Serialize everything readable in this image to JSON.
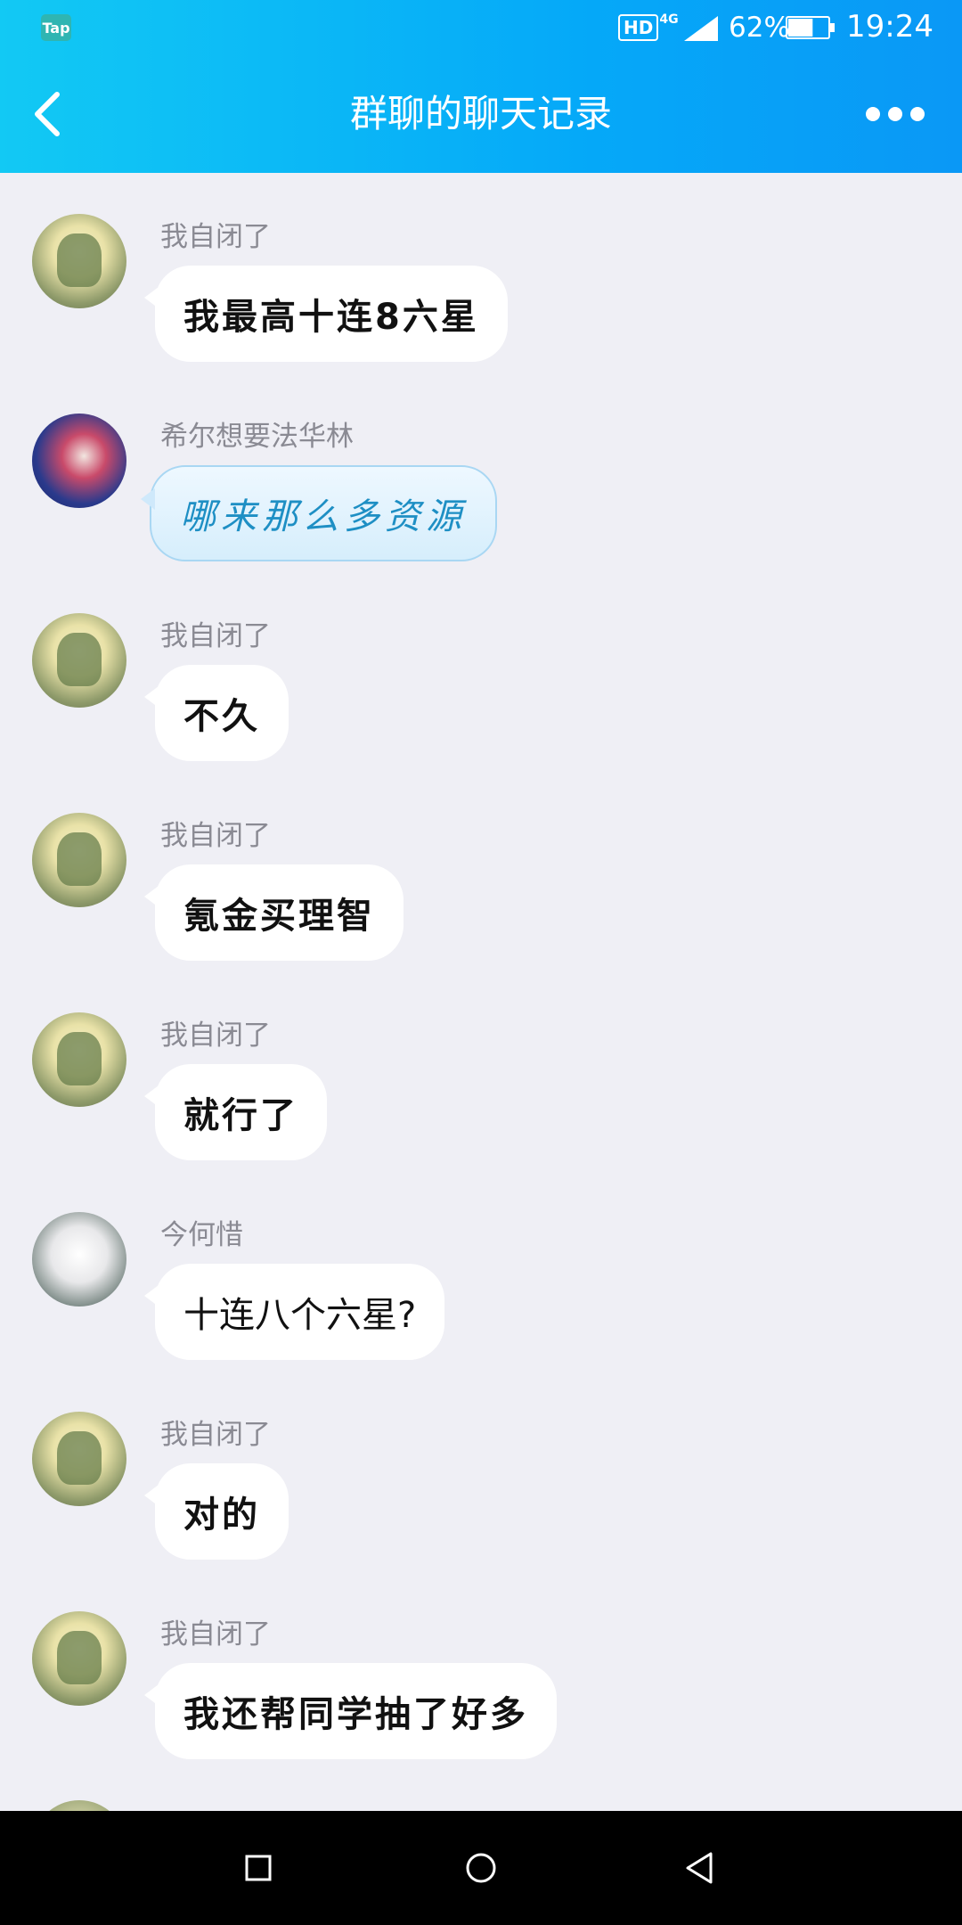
{
  "status_bar": {
    "app_badge": "Tap",
    "hd_label": "HD",
    "network": "4G",
    "battery_percent": "62%",
    "battery_level": 0.62,
    "time": "19:24"
  },
  "header": {
    "title": "群聊的聊天记录",
    "back_icon": "chevron-left-icon",
    "more_icon": "more-dots-icon"
  },
  "messages": [
    {
      "sender": "我自闭了",
      "text": "我最高十连8六星",
      "avatar": "green-hooded-character"
    },
    {
      "sender": "希尔想要法华林",
      "text": "哪来那么多资源",
      "avatar": "blue-haired-character"
    },
    {
      "sender": "我自闭了",
      "text": "不久",
      "avatar": "green-hooded-character"
    },
    {
      "sender": "我自闭了",
      "text": "氪金买理智",
      "avatar": "green-hooded-character"
    },
    {
      "sender": "我自闭了",
      "text": "就行了",
      "avatar": "green-hooded-character"
    },
    {
      "sender": "今何惜",
      "text": "十连八个六星?",
      "avatar": "white-haired-character"
    },
    {
      "sender": "我自闭了",
      "text": "对的",
      "avatar": "green-hooded-character"
    },
    {
      "sender": "我自闭了",
      "text": "我还帮同学抽了好多",
      "avatar": "green-hooded-character"
    }
  ],
  "nav_bar": {
    "recents_icon": "square-icon",
    "home_icon": "circle-icon",
    "back_icon": "triangle-back-icon"
  }
}
